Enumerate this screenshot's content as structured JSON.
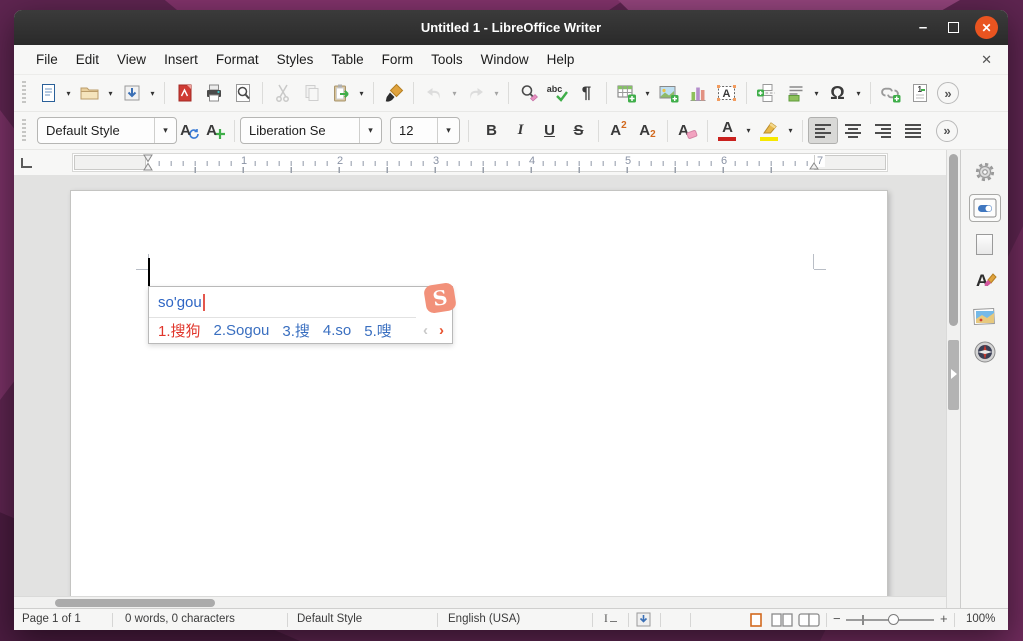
{
  "window": {
    "title": "Untitled 1 - LibreOffice Writer",
    "minimize_glyph": "–",
    "close_glyph": "✕"
  },
  "menu": {
    "items": [
      "File",
      "Edit",
      "View",
      "Insert",
      "Format",
      "Styles",
      "Table",
      "Form",
      "Tools",
      "Window",
      "Help"
    ],
    "close_document_glyph": "✕"
  },
  "ui": {
    "dropdown_glyph": "▾",
    "overflow_glyph": "»"
  },
  "toolbar": {
    "pilcrow_glyph": "¶",
    "omega_glyph": "Ω",
    "abc_label": "abc"
  },
  "formatting": {
    "paragraph_style": "Default Style",
    "font_name": "Liberation Se",
    "font_size": "12",
    "bold_glyph": "B",
    "italic_glyph": "I",
    "underline_glyph": "U",
    "strikethrough_glyph": "S",
    "super_base": "A",
    "super_exp": "2",
    "sub_base": "A",
    "sub_idx": "2",
    "clear_base": "A",
    "fontcolor_base": "A",
    "style_base": "A"
  },
  "ruler": {
    "numbers": [
      "1",
      "2",
      "3",
      "4",
      "5",
      "6",
      "7"
    ]
  },
  "ime": {
    "composition": "so'gou",
    "candidates": [
      "1.搜狗",
      "2.Sogou",
      "3.搜",
      "4.so",
      "5.嗖"
    ],
    "prev_glyph": "‹",
    "next_glyph": "›",
    "logo_glyph": "S"
  },
  "statusbar": {
    "page_count": "Page 1 of 1",
    "word_count": "0 words, 0 characters",
    "paragraph_style": "Default Style",
    "language": "English (USA)",
    "selection_mode": "I",
    "zoom_minus": "−",
    "zoom_plus": "+",
    "zoom_level": "100%"
  },
  "colors": {
    "accent": "#E95420",
    "ime_blue": "#2f66c4",
    "ime_red": "#e0352b",
    "logo_coral": "#f2917a"
  }
}
